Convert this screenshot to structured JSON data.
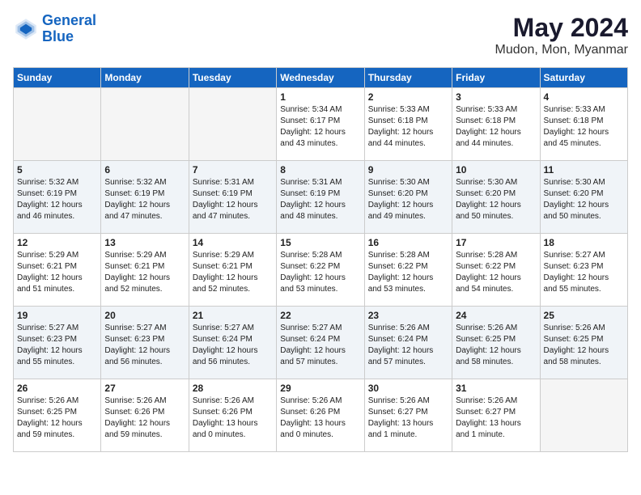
{
  "logo": {
    "line1": "General",
    "line2": "Blue"
  },
  "title": "May 2024",
  "location": "Mudon, Mon, Myanmar",
  "weekdays": [
    "Sunday",
    "Monday",
    "Tuesday",
    "Wednesday",
    "Thursday",
    "Friday",
    "Saturday"
  ],
  "weeks": [
    [
      {
        "day": "",
        "empty": true
      },
      {
        "day": "",
        "empty": true
      },
      {
        "day": "",
        "empty": true
      },
      {
        "day": "1",
        "sunrise": "Sunrise: 5:34 AM",
        "sunset": "Sunset: 6:17 PM",
        "daylight": "Daylight: 12 hours and 43 minutes."
      },
      {
        "day": "2",
        "sunrise": "Sunrise: 5:33 AM",
        "sunset": "Sunset: 6:18 PM",
        "daylight": "Daylight: 12 hours and 44 minutes."
      },
      {
        "day": "3",
        "sunrise": "Sunrise: 5:33 AM",
        "sunset": "Sunset: 6:18 PM",
        "daylight": "Daylight: 12 hours and 44 minutes."
      },
      {
        "day": "4",
        "sunrise": "Sunrise: 5:33 AM",
        "sunset": "Sunset: 6:18 PM",
        "daylight": "Daylight: 12 hours and 45 minutes."
      }
    ],
    [
      {
        "day": "5",
        "sunrise": "Sunrise: 5:32 AM",
        "sunset": "Sunset: 6:19 PM",
        "daylight": "Daylight: 12 hours and 46 minutes."
      },
      {
        "day": "6",
        "sunrise": "Sunrise: 5:32 AM",
        "sunset": "Sunset: 6:19 PM",
        "daylight": "Daylight: 12 hours and 47 minutes."
      },
      {
        "day": "7",
        "sunrise": "Sunrise: 5:31 AM",
        "sunset": "Sunset: 6:19 PM",
        "daylight": "Daylight: 12 hours and 47 minutes."
      },
      {
        "day": "8",
        "sunrise": "Sunrise: 5:31 AM",
        "sunset": "Sunset: 6:19 PM",
        "daylight": "Daylight: 12 hours and 48 minutes."
      },
      {
        "day": "9",
        "sunrise": "Sunrise: 5:30 AM",
        "sunset": "Sunset: 6:20 PM",
        "daylight": "Daylight: 12 hours and 49 minutes."
      },
      {
        "day": "10",
        "sunrise": "Sunrise: 5:30 AM",
        "sunset": "Sunset: 6:20 PM",
        "daylight": "Daylight: 12 hours and 50 minutes."
      },
      {
        "day": "11",
        "sunrise": "Sunrise: 5:30 AM",
        "sunset": "Sunset: 6:20 PM",
        "daylight": "Daylight: 12 hours and 50 minutes."
      }
    ],
    [
      {
        "day": "12",
        "sunrise": "Sunrise: 5:29 AM",
        "sunset": "Sunset: 6:21 PM",
        "daylight": "Daylight: 12 hours and 51 minutes."
      },
      {
        "day": "13",
        "sunrise": "Sunrise: 5:29 AM",
        "sunset": "Sunset: 6:21 PM",
        "daylight": "Daylight: 12 hours and 52 minutes."
      },
      {
        "day": "14",
        "sunrise": "Sunrise: 5:29 AM",
        "sunset": "Sunset: 6:21 PM",
        "daylight": "Daylight: 12 hours and 52 minutes."
      },
      {
        "day": "15",
        "sunrise": "Sunrise: 5:28 AM",
        "sunset": "Sunset: 6:22 PM",
        "daylight": "Daylight: 12 hours and 53 minutes."
      },
      {
        "day": "16",
        "sunrise": "Sunrise: 5:28 AM",
        "sunset": "Sunset: 6:22 PM",
        "daylight": "Daylight: 12 hours and 53 minutes."
      },
      {
        "day": "17",
        "sunrise": "Sunrise: 5:28 AM",
        "sunset": "Sunset: 6:22 PM",
        "daylight": "Daylight: 12 hours and 54 minutes."
      },
      {
        "day": "18",
        "sunrise": "Sunrise: 5:27 AM",
        "sunset": "Sunset: 6:23 PM",
        "daylight": "Daylight: 12 hours and 55 minutes."
      }
    ],
    [
      {
        "day": "19",
        "sunrise": "Sunrise: 5:27 AM",
        "sunset": "Sunset: 6:23 PM",
        "daylight": "Daylight: 12 hours and 55 minutes."
      },
      {
        "day": "20",
        "sunrise": "Sunrise: 5:27 AM",
        "sunset": "Sunset: 6:23 PM",
        "daylight": "Daylight: 12 hours and 56 minutes."
      },
      {
        "day": "21",
        "sunrise": "Sunrise: 5:27 AM",
        "sunset": "Sunset: 6:24 PM",
        "daylight": "Daylight: 12 hours and 56 minutes."
      },
      {
        "day": "22",
        "sunrise": "Sunrise: 5:27 AM",
        "sunset": "Sunset: 6:24 PM",
        "daylight": "Daylight: 12 hours and 57 minutes."
      },
      {
        "day": "23",
        "sunrise": "Sunrise: 5:26 AM",
        "sunset": "Sunset: 6:24 PM",
        "daylight": "Daylight: 12 hours and 57 minutes."
      },
      {
        "day": "24",
        "sunrise": "Sunrise: 5:26 AM",
        "sunset": "Sunset: 6:25 PM",
        "daylight": "Daylight: 12 hours and 58 minutes."
      },
      {
        "day": "25",
        "sunrise": "Sunrise: 5:26 AM",
        "sunset": "Sunset: 6:25 PM",
        "daylight": "Daylight: 12 hours and 58 minutes."
      }
    ],
    [
      {
        "day": "26",
        "sunrise": "Sunrise: 5:26 AM",
        "sunset": "Sunset: 6:25 PM",
        "daylight": "Daylight: 12 hours and 59 minutes."
      },
      {
        "day": "27",
        "sunrise": "Sunrise: 5:26 AM",
        "sunset": "Sunset: 6:26 PM",
        "daylight": "Daylight: 12 hours and 59 minutes."
      },
      {
        "day": "28",
        "sunrise": "Sunrise: 5:26 AM",
        "sunset": "Sunset: 6:26 PM",
        "daylight": "Daylight: 13 hours and 0 minutes."
      },
      {
        "day": "29",
        "sunrise": "Sunrise: 5:26 AM",
        "sunset": "Sunset: 6:26 PM",
        "daylight": "Daylight: 13 hours and 0 minutes."
      },
      {
        "day": "30",
        "sunrise": "Sunrise: 5:26 AM",
        "sunset": "Sunset: 6:27 PM",
        "daylight": "Daylight: 13 hours and 1 minute."
      },
      {
        "day": "31",
        "sunrise": "Sunrise: 5:26 AM",
        "sunset": "Sunset: 6:27 PM",
        "daylight": "Daylight: 13 hours and 1 minute."
      },
      {
        "day": "",
        "empty": true
      }
    ]
  ]
}
